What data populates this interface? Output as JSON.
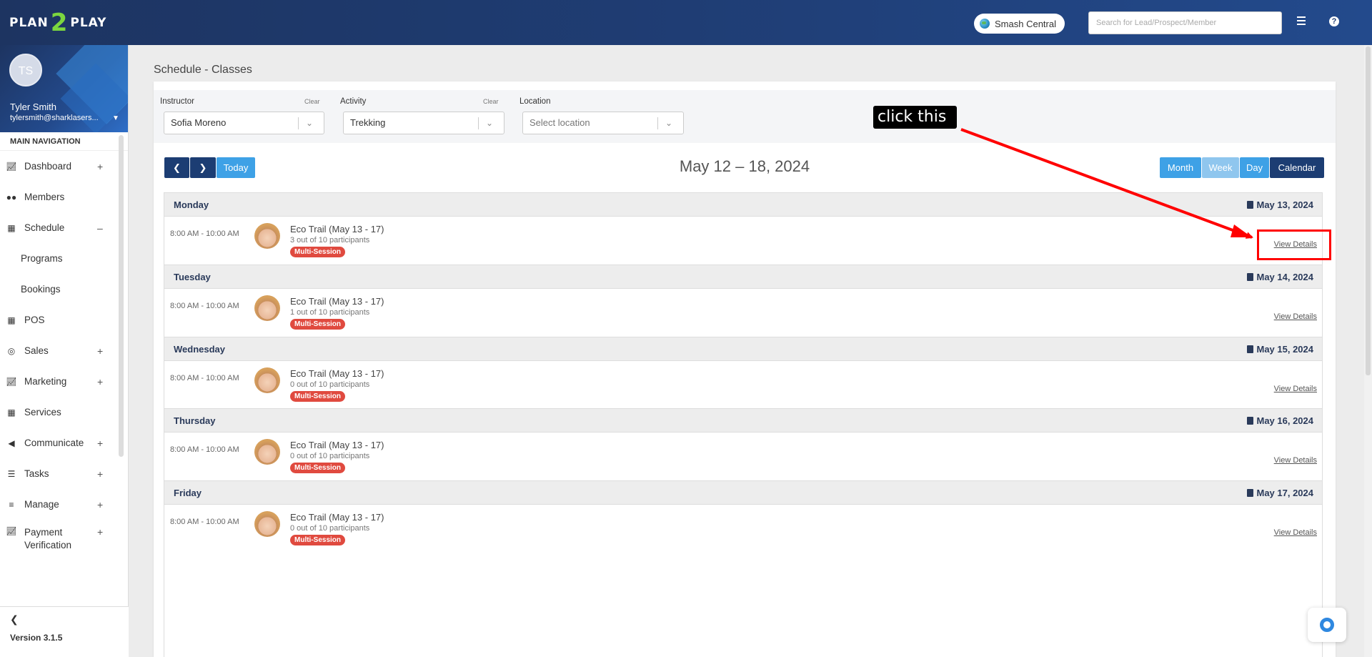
{
  "header": {
    "logo_left": "PLAN",
    "logo_mid": "2",
    "logo_right": "PLAY",
    "org_name": "Smash Central",
    "search_placeholder": "Search for Lead/Prospect/Member"
  },
  "profile": {
    "initials": "TS",
    "name": "Tyler Smith",
    "email": "tylersmith@sharklasers..."
  },
  "sidebar": {
    "heading": "MAIN NAVIGATION",
    "items": [
      {
        "label": "Dashboard",
        "icon": "chart-icon",
        "toggle": "+"
      },
      {
        "label": "Members",
        "icon": "users-icon",
        "toggle": ""
      },
      {
        "label": "Schedule",
        "icon": "calendar-icon",
        "toggle": "–"
      },
      {
        "label": "Programs",
        "icon": "",
        "toggle": ""
      },
      {
        "label": "Bookings",
        "icon": "",
        "toggle": ""
      },
      {
        "label": "POS",
        "icon": "grid-icon",
        "toggle": ""
      },
      {
        "label": "Sales",
        "icon": "target-icon",
        "toggle": "+"
      },
      {
        "label": "Marketing",
        "icon": "chart-icon",
        "toggle": "+"
      },
      {
        "label": "Services",
        "icon": "grid-icon",
        "toggle": ""
      },
      {
        "label": "Communicate",
        "icon": "megaphone-icon",
        "toggle": "+"
      },
      {
        "label": "Tasks",
        "icon": "list-icon",
        "toggle": "+"
      },
      {
        "label": "Manage",
        "icon": "bars-icon",
        "toggle": "+"
      },
      {
        "label": "Payment Verification",
        "icon": "chart-icon",
        "toggle": "+"
      }
    ],
    "version": "Version 3.1.5"
  },
  "page": {
    "title": "Schedule - Classes"
  },
  "filters": {
    "instructor_label": "Instructor",
    "instructor_value": "Sofia Moreno",
    "activity_label": "Activity",
    "activity_value": "Trekking",
    "location_label": "Location",
    "location_placeholder": "Select location",
    "clear_label": "Clear"
  },
  "calendar": {
    "today_label": "Today",
    "range": "May 12 – 18, 2024",
    "views": [
      "Month",
      "Week",
      "Day",
      "Calendar"
    ],
    "active_view": "Week",
    "view_details_label": "View Details",
    "days": [
      {
        "day": "Monday",
        "date": "May 13, 2024",
        "time": "8:00 AM - 10:00 AM",
        "event": "Eco Trail (May 13 - 17)",
        "participants": "3 out of 10 participants",
        "badge": "Multi-Session"
      },
      {
        "day": "Tuesday",
        "date": "May 14, 2024",
        "time": "8:00 AM - 10:00 AM",
        "event": "Eco Trail (May 13 - 17)",
        "participants": "1 out of 10 participants",
        "badge": "Multi-Session"
      },
      {
        "day": "Wednesday",
        "date": "May 15, 2024",
        "time": "8:00 AM - 10:00 AM",
        "event": "Eco Trail (May 13 - 17)",
        "participants": "0 out of 10 participants",
        "badge": "Multi-Session"
      },
      {
        "day": "Thursday",
        "date": "May 16, 2024",
        "time": "8:00 AM - 10:00 AM",
        "event": "Eco Trail (May 13 - 17)",
        "participants": "0 out of 10 participants",
        "badge": "Multi-Session"
      },
      {
        "day": "Friday",
        "date": "May 17, 2024",
        "time": "8:00 AM - 10:00 AM",
        "event": "Eco Trail (May 13 - 17)",
        "participants": "0 out of 10 participants",
        "badge": "Multi-Session"
      }
    ]
  },
  "annotation": {
    "text": "click this",
    "color": "#ff0000"
  },
  "colors": {
    "header": "#1f3d74",
    "primary_button": "#3ea1e6",
    "dark_button": "#1c3d73",
    "badge": "#e04a3f"
  }
}
